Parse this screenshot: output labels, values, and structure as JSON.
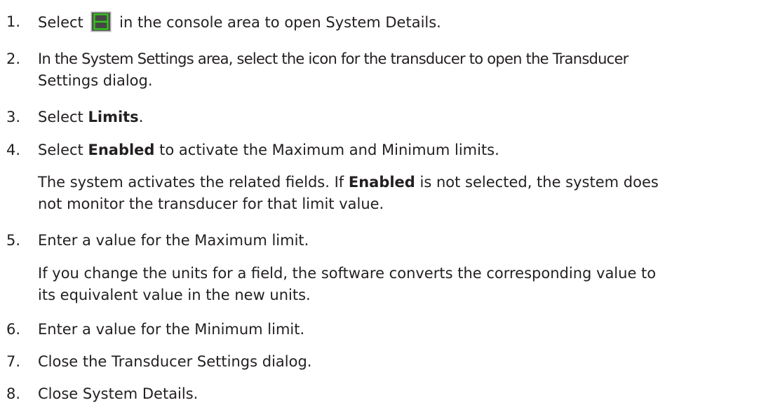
{
  "steps": [
    {
      "number": "1.",
      "text_before": "Select",
      "icon": "system-details-console-icon",
      "text_after": "in the console area to open System Details."
    },
    {
      "number": "2.",
      "line1": "In the System Settings area, select the icon for the transducer to open the Transducer",
      "line2": "Settings dialog."
    },
    {
      "number": "3.",
      "text_before": "Select",
      "bold": "Limits",
      "text_after": "."
    },
    {
      "number": "4.",
      "text_before": "Select",
      "bold": "Enabled",
      "text_after": "to activate the Maximum and Minimum limits.",
      "note_line1_before": "The system activates the related fields. If",
      "note_bold": "Enabled",
      "note_line1_after": "is not selected, the system does",
      "note_line2": "not monitor the transducer for that limit value."
    },
    {
      "number": "5.",
      "text": "Enter a value for the Maximum limit.",
      "note_line1": "If you change the units for a field, the software converts the corresponding value to",
      "note_line2": "its equivalent value in the new units."
    },
    {
      "number": "6.",
      "text": "Enter a value for the Minimum limit."
    },
    {
      "number": "7.",
      "text": "Close the Transducer Settings dialog."
    },
    {
      "number": "8.",
      "text": "Close System Details."
    }
  ],
  "colors": {
    "text": "#231f20",
    "icon_fill": "#4d4d4d",
    "icon_border": "#b0b0b0",
    "icon_highlight": "#34c51b"
  }
}
